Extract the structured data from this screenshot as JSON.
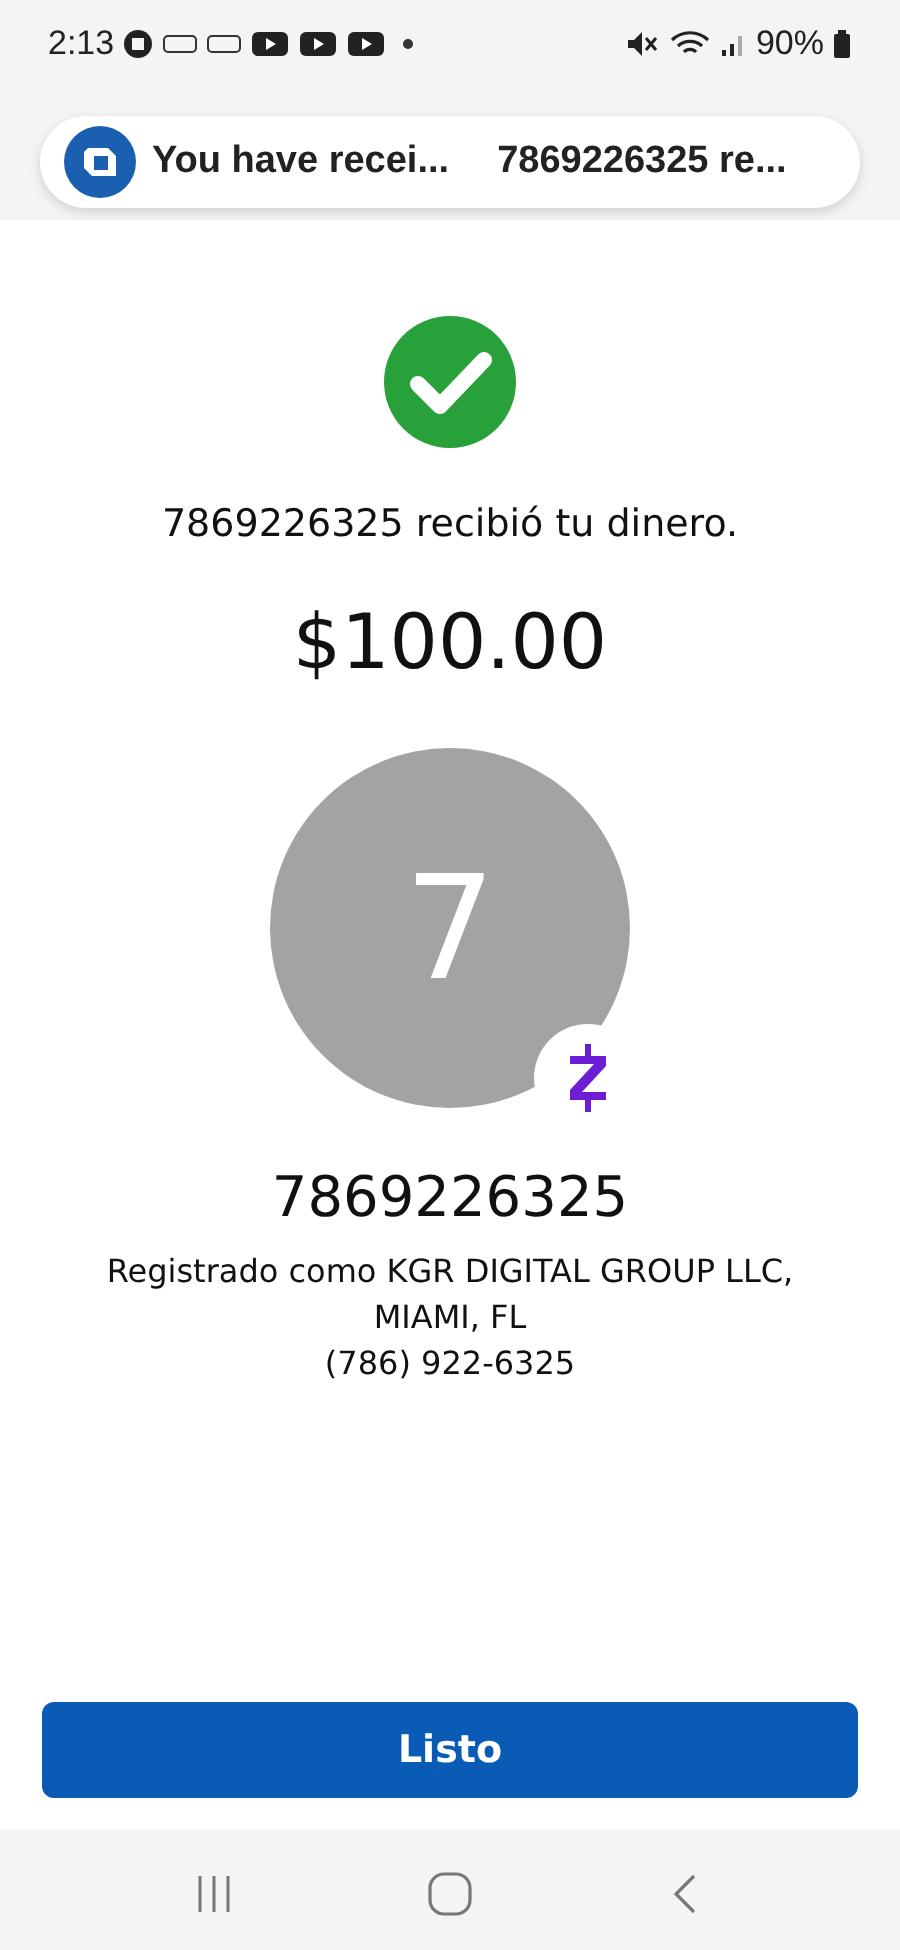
{
  "status_bar": {
    "time": "2:13",
    "battery": "90%"
  },
  "notification": {
    "title": "You have recei...",
    "text": "7869226325 re..."
  },
  "confirmation": {
    "message": "7869226325 recibió tu dinero.",
    "amount": "$100.00"
  },
  "recipient": {
    "avatar_letter": "7",
    "name": "7869226325",
    "registered": "Registrado como KGR DIGITAL GROUP LLC,",
    "location": "MIAMI, FL",
    "phone": "(786) 922-6325"
  },
  "button": {
    "label": "Listo"
  }
}
